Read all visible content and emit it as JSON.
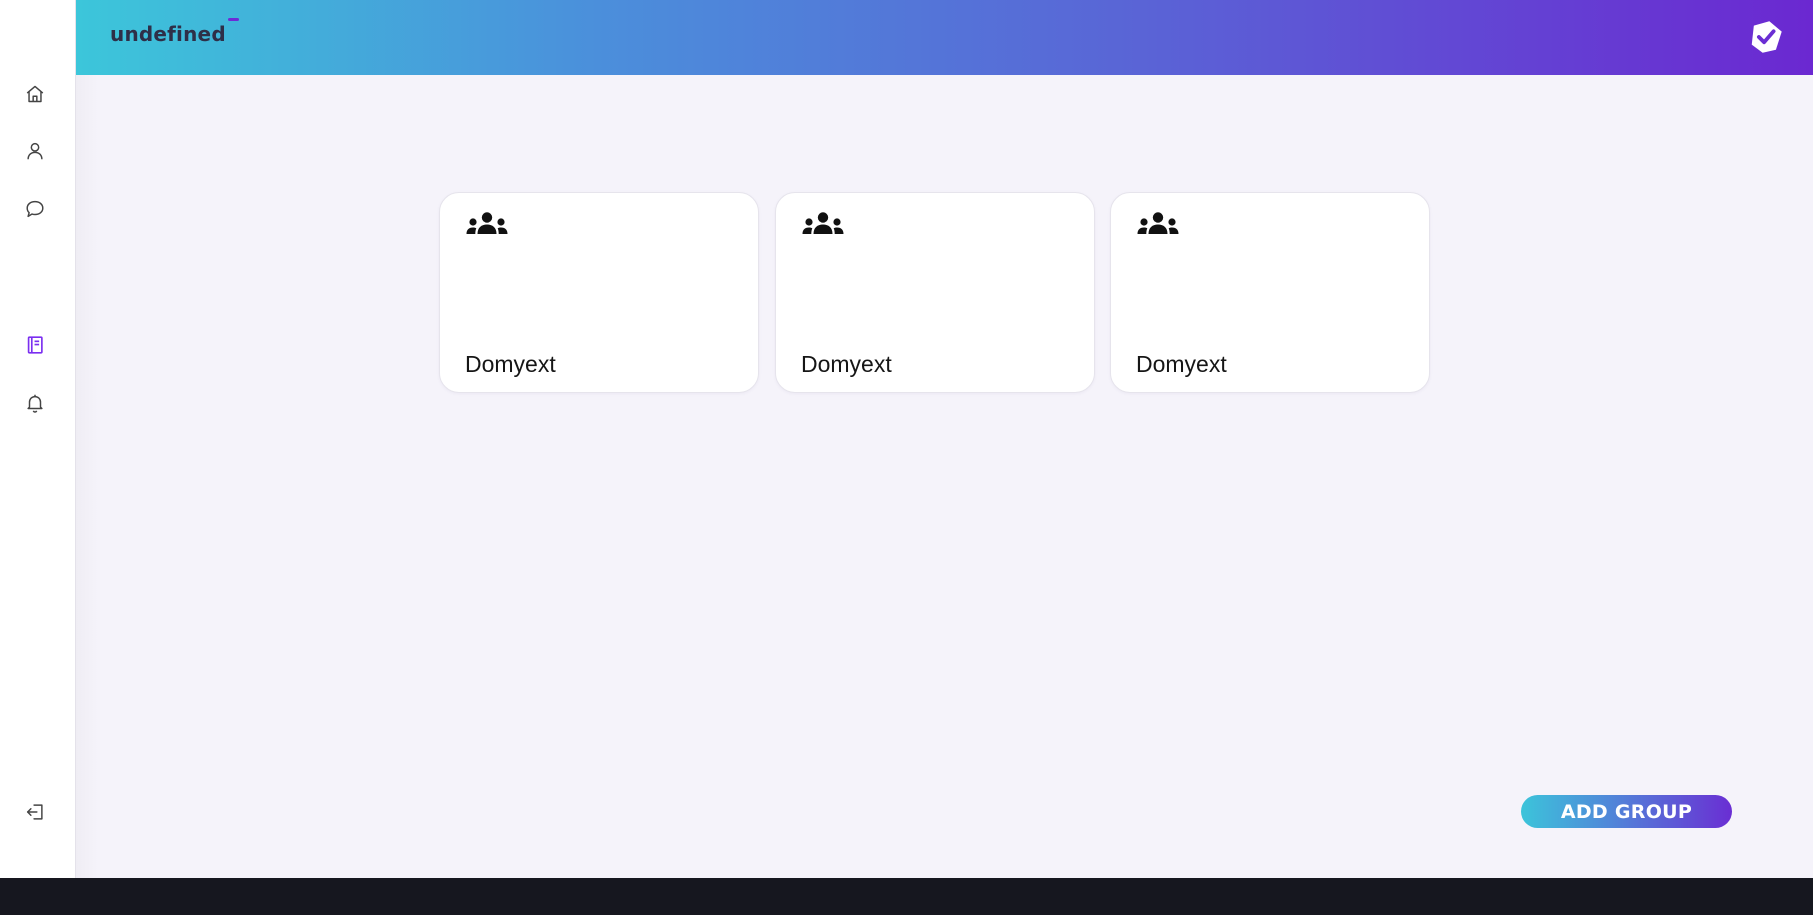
{
  "header": {
    "brand": "undefined",
    "logo_icon": "check-shield-icon",
    "gradient_start": "#3cc6da",
    "gradient_end": "#6b28d1"
  },
  "sidebar": {
    "items": [
      {
        "icon": "home-icon",
        "active": false
      },
      {
        "icon": "user-icon",
        "active": false
      },
      {
        "icon": "chat-bubble-icon",
        "active": false
      },
      {
        "icon": "notebook-icon",
        "active": true
      },
      {
        "icon": "bell-icon",
        "active": false
      }
    ],
    "logout_icon": "logout-icon",
    "active_color": "#7b2ff0",
    "icon_color": "#444444"
  },
  "groups": [
    {
      "name": "Domyext",
      "icon": "group-icon"
    },
    {
      "name": "Domyext",
      "icon": "group-icon"
    },
    {
      "name": "Domyext",
      "icon": "group-icon"
    }
  ],
  "actions": {
    "add_group_label": "ADD GROUP"
  }
}
